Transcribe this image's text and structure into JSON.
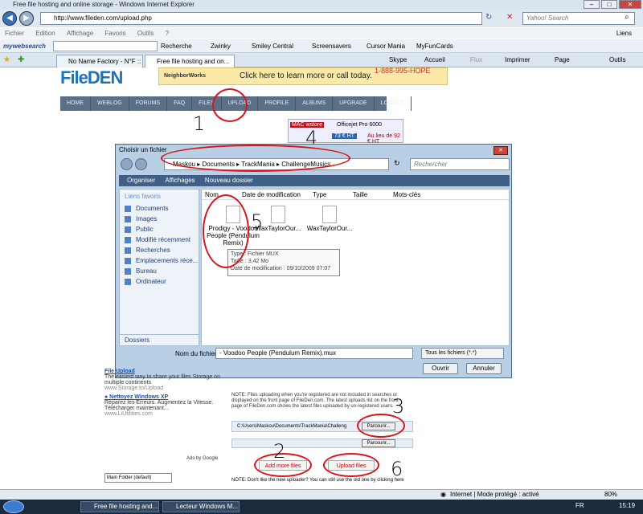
{
  "browser": {
    "title": "Free file hosting and online storage - Windows Internet Explorer",
    "url": "http://www.fileden.com/upload.php",
    "search_placeholder": "Yahoo! Search",
    "menu": [
      "Fichier",
      "Edition",
      "Affichage",
      "Favoris",
      "Outils",
      "?"
    ],
    "links_label": "Liens",
    "toolbar": {
      "brand": "mywebsearch",
      "search_btn": "Recherche",
      "items": [
        "Zwinky",
        "Smiley Central",
        "Screensavers",
        "Cursor Mania",
        "MyFunCards"
      ]
    },
    "tabs": [
      {
        "label": "No Name Factory - N°F :: ..."
      },
      {
        "label": "Free file hosting and on..."
      }
    ],
    "commands": [
      "Skype",
      "Accueil",
      "Flux",
      "Imprimer",
      "Page",
      "Outils"
    ]
  },
  "site": {
    "logo": "FileDEN",
    "ad_banner_text": "Click here to learn more or call today.",
    "ad_banner_brand": "NeighborWorks",
    "ad_phone": "1-888-995-HOPE",
    "nav": [
      "HOME",
      "WEBLOG",
      "FORUMS",
      "FAQ",
      "FILES",
      "UPLOAD",
      "PROFILE",
      "ALBUMS",
      "UPGRADE",
      "LOGOUT"
    ],
    "officejet": {
      "title": "Officejet Pro 6000",
      "price": "73 € HT",
      "old": "Au lieu de 92 € HT",
      "brand": "MAC wstore"
    }
  },
  "annotations": {
    "n1": "1",
    "n3": "3",
    "n4": "4",
    "n5": "5",
    "n6": "6",
    "n2": "2"
  },
  "dialog": {
    "title": "Choisir un fichier",
    "path": [
      "Maskou",
      "Documents",
      "TrackMania",
      "ChallengeMusics"
    ],
    "search_placeholder": "Rechercher",
    "toolbar": [
      "Organiser",
      "Affichages",
      "Nouveau dossier"
    ],
    "side_heading": "Liens favoris",
    "side_items": [
      "Documents",
      "Images",
      "Public",
      "Modifié récemment",
      "Recherches",
      "Emplacements réce...",
      "Bureau",
      "Ordinateur"
    ],
    "folders_label": "Dossiers",
    "columns": [
      "Nom",
      "Date de modification",
      "Type",
      "Taille",
      "Mots-clés"
    ],
    "files": [
      {
        "name": "Prodigy - Voodoo People (Pendulum Remix)"
      },
      {
        "name": "WaxTaylorOur..."
      },
      {
        "name": "WaxTaylorOur..."
      }
    ],
    "tooltip": {
      "type": "Type : Fichier MUX",
      "size": "Taille : 3,42 Mo",
      "date": "Date de modification : 09/10/2009 07:07"
    },
    "filename_label": "Nom du fichier :",
    "filename_value": "- Voodoo People (Pendulum Remix).mux",
    "filetype": "Tous les fichiers (*.*)",
    "open_btn": "Ouvrir",
    "cancel_btn": "Annuler"
  },
  "ads": [
    {
      "title": "File Upload",
      "desc": "The easiest way to share your files Storage on multiple continents",
      "url": "www.Storage.to/Upload"
    },
    {
      "title": "● Nettoyez Windows XP",
      "desc": "Réparez les Erreurs. Augmentez la Vitesse. Télécharger maintenant...",
      "url": "www.LiUtilities.com"
    }
  ],
  "ads_by": "Ads by Google",
  "folder_select": "Main Folder (default)",
  "upload": {
    "note": "NOTE: Files uploading when you're registered are not included in searches or displayed on the front page of FileDen.com. The latest uploads list on the front page of FileDen.com shows the latest files uploaded by un-registered users.",
    "path_value": "C:\\Users\\Maskou\\Documents\\TrackMania\\Challeng",
    "browse": "Parcourir...",
    "add_more": "Add more files",
    "upload_btn": "Upload files",
    "bottom_note": "NOTE: Don't like the new uploader? You can still use the old one by clicking here"
  },
  "status": {
    "zone": "Internet | Mode protégé : activé",
    "zoom": "80%"
  },
  "taskbar": {
    "items": [
      "Free file hosting and...",
      "Lecteur Windows M..."
    ],
    "lang": "FR",
    "time": "15:19"
  }
}
